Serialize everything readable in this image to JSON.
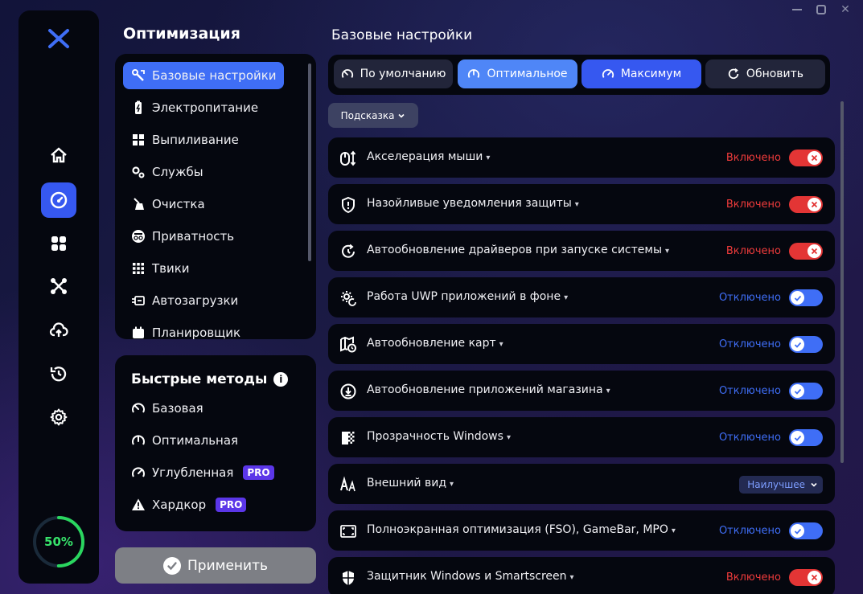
{
  "colors": {
    "accent": "#3f6ef6",
    "danger": "#e33535",
    "success": "#37e36b",
    "panel": "#05070f"
  },
  "window": {
    "controls": [
      "minimize-icon",
      "maximize-icon",
      "close-icon"
    ],
    "close_glyph": "✕"
  },
  "rail": {
    "logo": "x-logo-icon",
    "items": [
      "home-icon",
      "speedometer-icon",
      "apps-grid-icon",
      "network-nodes-icon",
      "cloud-upload-icon",
      "history-icon",
      "gear-icon"
    ],
    "active_index": 1,
    "progress": {
      "label": "50%",
      "value": 0.5
    }
  },
  "categories": {
    "title": "Оптимизация",
    "items": [
      {
        "label": "Базовые настройки",
        "icon": "tools-icon",
        "active": true
      },
      {
        "label": "Электропитание",
        "icon": "battery-icon"
      },
      {
        "label": "Выпиливание",
        "icon": "windows-icon"
      },
      {
        "label": "Службы",
        "icon": "gears-icon"
      },
      {
        "label": "Очистка",
        "icon": "broom-icon"
      },
      {
        "label": "Приватность",
        "icon": "incognito-icon"
      },
      {
        "label": "Твики",
        "icon": "grid-dots-icon"
      },
      {
        "label": "Автозагрузки",
        "icon": "startup-icon"
      },
      {
        "label": "Планировщик",
        "icon": "calendar-icon"
      }
    ]
  },
  "quick": {
    "title": "Быстрые методы",
    "info_glyph": "i",
    "items": [
      {
        "label": "Базовая",
        "icon": "gauge-low-icon",
        "pro": false
      },
      {
        "label": "Оптимальная",
        "icon": "gauge-mid-icon",
        "pro": false
      },
      {
        "label": "Углубленная",
        "icon": "gauge-high-icon",
        "pro": true
      },
      {
        "label": "Хардкор",
        "icon": "warning-icon",
        "pro": true
      }
    ],
    "pro_label": "PRO"
  },
  "apply": {
    "label": "Применить"
  },
  "main": {
    "title": "Базовые настройки",
    "presets": [
      {
        "label": "По умолчанию",
        "icon": "gauge-low-icon",
        "active": false
      },
      {
        "label": "Оптимальное",
        "icon": "gauge-mid-icon",
        "active": true
      },
      {
        "label": "Максимум",
        "icon": "gauge-high-icon",
        "active": true
      },
      {
        "label": "Обновить",
        "icon": "refresh-icon",
        "active": false
      }
    ],
    "hint": {
      "label": "Подсказка"
    },
    "rows": [
      {
        "label": "Акселерация мыши",
        "icon": "mouse-icon",
        "status": "Включено",
        "state": "on"
      },
      {
        "label": "Назойливые уведомления защиты",
        "icon": "shield-alert-icon",
        "status": "Включено",
        "state": "on"
      },
      {
        "label": "Автообновление драйверов при запуске системы",
        "icon": "driver-update-icon",
        "status": "Включено",
        "state": "on"
      },
      {
        "label": "Работа UWP приложений в фоне",
        "icon": "gear-refresh-icon",
        "status": "Отключено",
        "state": "off"
      },
      {
        "label": "Автообновление карт",
        "icon": "map-clock-icon",
        "status": "Отключено",
        "state": "off"
      },
      {
        "label": "Автообновление приложений магазина",
        "icon": "download-circle-icon",
        "status": "Отключено",
        "state": "off"
      },
      {
        "label": "Прозрачность Windows",
        "icon": "transparency-icon",
        "status": "Отключено",
        "state": "off"
      },
      {
        "label": "Внешний вид",
        "icon": "font-style-icon",
        "select": "Наилучшее"
      },
      {
        "label": "Полноэкранная оптимизация (FSO), GameBar, MPO",
        "icon": "fullscreen-icon",
        "status": "Отключено",
        "state": "off"
      },
      {
        "label": "Защитник Windows и Smartscreen",
        "icon": "defender-icon",
        "status": "Включено",
        "state": "on"
      }
    ]
  }
}
